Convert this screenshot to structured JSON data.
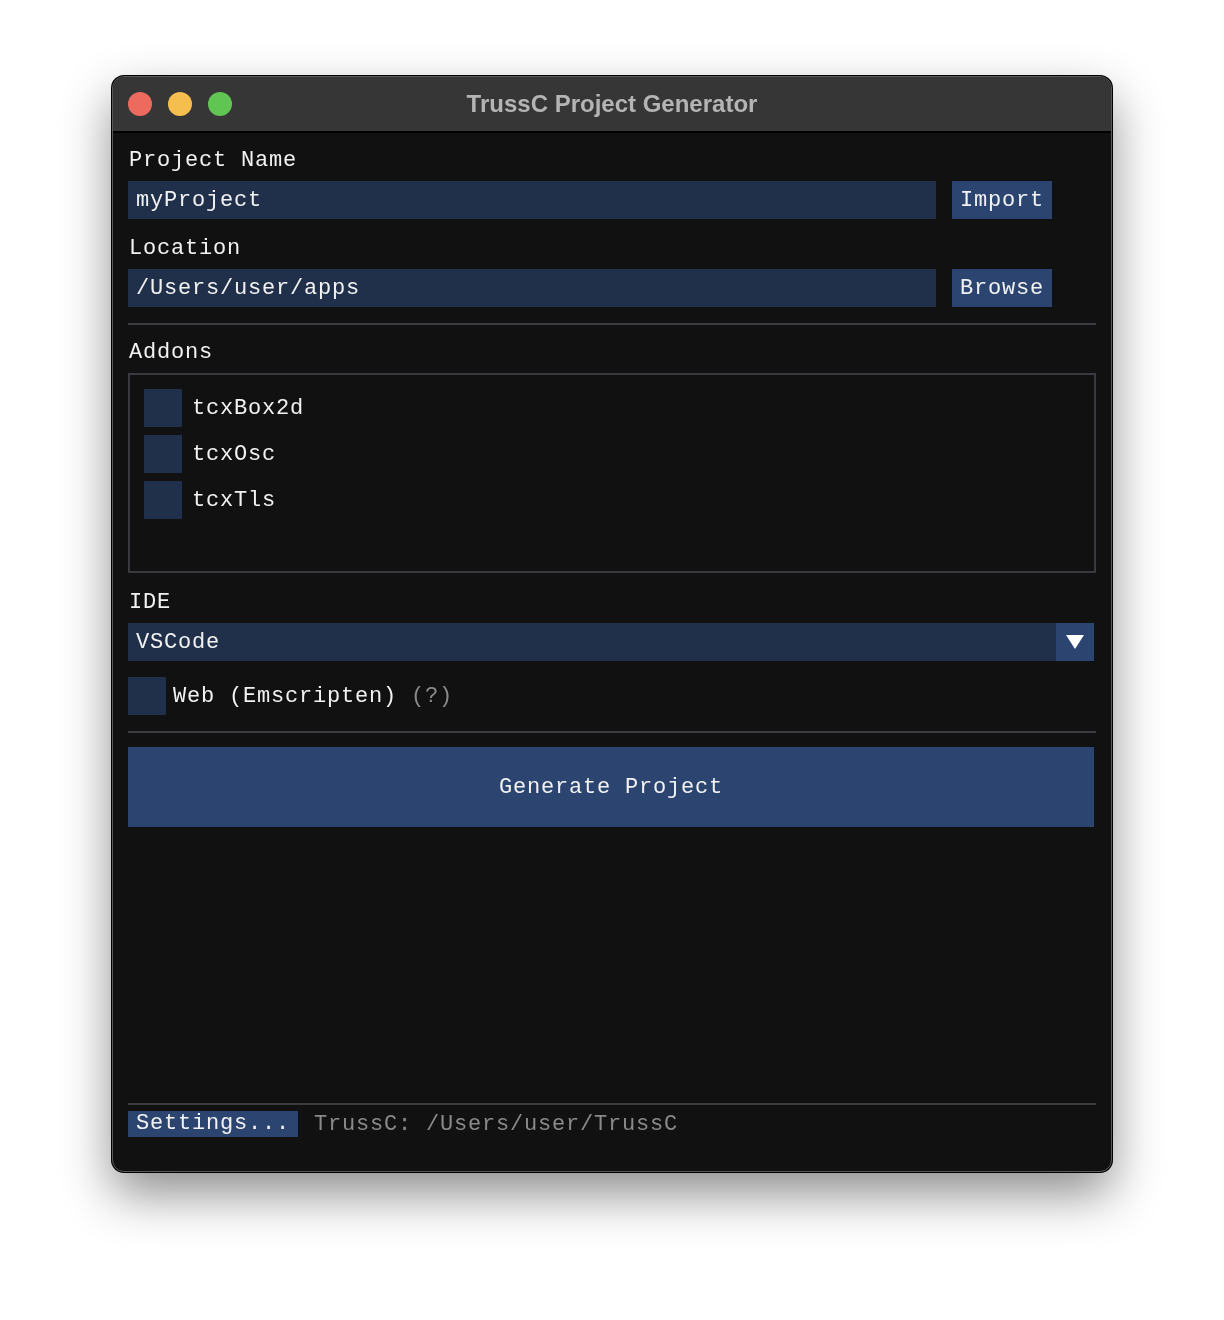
{
  "window": {
    "title": "TrussC Project Generator"
  },
  "project_name": {
    "label": "Project Name",
    "value": "myProject",
    "button": "Import"
  },
  "location": {
    "label": "Location",
    "value": "/Users/user/apps",
    "button": "Browse"
  },
  "addons": {
    "label": "Addons",
    "items": [
      {
        "name": "tcxBox2d",
        "checked": false
      },
      {
        "name": "tcxOsc",
        "checked": false
      },
      {
        "name": "tcxTls",
        "checked": false
      }
    ]
  },
  "ide": {
    "label": "IDE",
    "value": "VSCode"
  },
  "web_option": {
    "label": "Web (Emscripten)",
    "checked": false,
    "help": "(?)"
  },
  "generate_button": "Generate Project",
  "status_bar": {
    "settings_button": "Settings...",
    "path": "TrussC: /Users/user/TrussC"
  }
}
